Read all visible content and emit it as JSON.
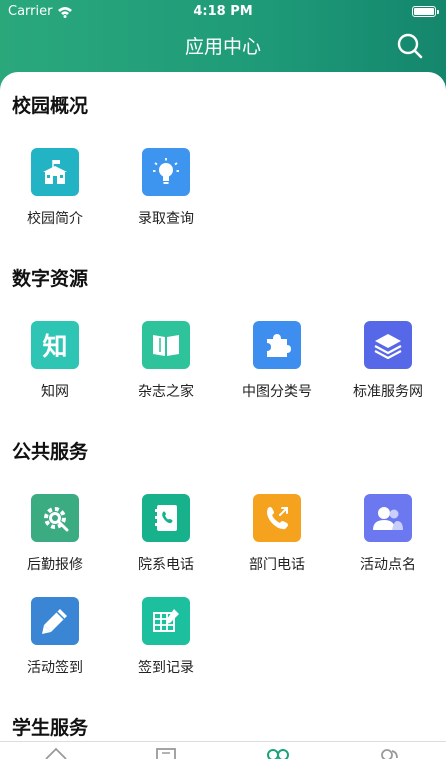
{
  "status": {
    "carrier": "Carrier",
    "time": "4:18 PM"
  },
  "nav": {
    "title": "应用中心"
  },
  "colors": {
    "header_start": "#2aa87c",
    "header_end": "#14866c",
    "tab_active": "#1aa37a",
    "tab_inactive": "#9a9a9a"
  },
  "sections": [
    {
      "title": "校园概况",
      "apps": [
        {
          "label": "校园简介",
          "icon": "school-building-icon",
          "color": "#22b4c4"
        },
        {
          "label": "录取查询",
          "icon": "lightbulb-icon",
          "color": "#3d95ef"
        }
      ]
    },
    {
      "title": "数字资源",
      "apps": [
        {
          "label": "知网",
          "icon": "zhi-character-icon",
          "glyph": "知",
          "color": "#2ec5b4"
        },
        {
          "label": "杂志之家",
          "icon": "open-book-icon",
          "color": "#2ec39a"
        },
        {
          "label": "中图分类号",
          "icon": "puzzle-piece-icon",
          "color": "#3e8ef0"
        },
        {
          "label": "标准服务网",
          "icon": "layers-icon",
          "color": "#5667e8"
        }
      ]
    },
    {
      "title": "公共服务",
      "apps": [
        {
          "label": "后勤报修",
          "icon": "gear-wrench-icon",
          "color": "#3bab82"
        },
        {
          "label": "院系电话",
          "icon": "phone-book-icon",
          "color": "#17b18c"
        },
        {
          "label": "部门电话",
          "icon": "phone-call-icon",
          "color": "#f5a21e"
        },
        {
          "label": "活动点名",
          "icon": "people-icon",
          "color": "#6b78f0"
        },
        {
          "label": "活动签到",
          "icon": "pencil-icon",
          "color": "#3a86d4"
        },
        {
          "label": "签到记录",
          "icon": "grid-edit-icon",
          "color": "#1cbf9e"
        }
      ]
    },
    {
      "title": "学生服务",
      "apps": []
    }
  ],
  "tabs": [
    {
      "icon": "home-icon"
    },
    {
      "icon": "news-icon"
    },
    {
      "icon": "apps-icon",
      "active": true
    },
    {
      "icon": "profile-icon"
    }
  ]
}
